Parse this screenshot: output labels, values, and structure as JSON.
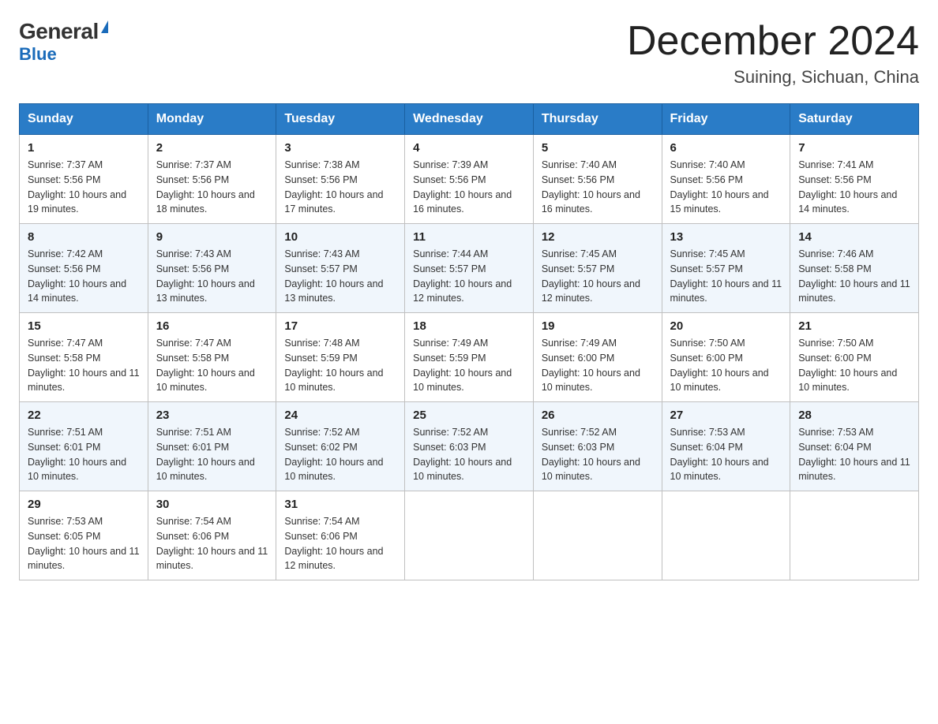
{
  "header": {
    "logo_general": "General",
    "logo_blue": "Blue",
    "month_year": "December 2024",
    "location": "Suining, Sichuan, China"
  },
  "weekdays": [
    "Sunday",
    "Monday",
    "Tuesday",
    "Wednesday",
    "Thursday",
    "Friday",
    "Saturday"
  ],
  "weeks": [
    [
      {
        "day": "1",
        "sunrise": "7:37 AM",
        "sunset": "5:56 PM",
        "daylight": "10 hours and 19 minutes."
      },
      {
        "day": "2",
        "sunrise": "7:37 AM",
        "sunset": "5:56 PM",
        "daylight": "10 hours and 18 minutes."
      },
      {
        "day": "3",
        "sunrise": "7:38 AM",
        "sunset": "5:56 PM",
        "daylight": "10 hours and 17 minutes."
      },
      {
        "day": "4",
        "sunrise": "7:39 AM",
        "sunset": "5:56 PM",
        "daylight": "10 hours and 16 minutes."
      },
      {
        "day": "5",
        "sunrise": "7:40 AM",
        "sunset": "5:56 PM",
        "daylight": "10 hours and 16 minutes."
      },
      {
        "day": "6",
        "sunrise": "7:40 AM",
        "sunset": "5:56 PM",
        "daylight": "10 hours and 15 minutes."
      },
      {
        "day": "7",
        "sunrise": "7:41 AM",
        "sunset": "5:56 PM",
        "daylight": "10 hours and 14 minutes."
      }
    ],
    [
      {
        "day": "8",
        "sunrise": "7:42 AM",
        "sunset": "5:56 PM",
        "daylight": "10 hours and 14 minutes."
      },
      {
        "day": "9",
        "sunrise": "7:43 AM",
        "sunset": "5:56 PM",
        "daylight": "10 hours and 13 minutes."
      },
      {
        "day": "10",
        "sunrise": "7:43 AM",
        "sunset": "5:57 PM",
        "daylight": "10 hours and 13 minutes."
      },
      {
        "day": "11",
        "sunrise": "7:44 AM",
        "sunset": "5:57 PM",
        "daylight": "10 hours and 12 minutes."
      },
      {
        "day": "12",
        "sunrise": "7:45 AM",
        "sunset": "5:57 PM",
        "daylight": "10 hours and 12 minutes."
      },
      {
        "day": "13",
        "sunrise": "7:45 AM",
        "sunset": "5:57 PM",
        "daylight": "10 hours and 11 minutes."
      },
      {
        "day": "14",
        "sunrise": "7:46 AM",
        "sunset": "5:58 PM",
        "daylight": "10 hours and 11 minutes."
      }
    ],
    [
      {
        "day": "15",
        "sunrise": "7:47 AM",
        "sunset": "5:58 PM",
        "daylight": "10 hours and 11 minutes."
      },
      {
        "day": "16",
        "sunrise": "7:47 AM",
        "sunset": "5:58 PM",
        "daylight": "10 hours and 10 minutes."
      },
      {
        "day": "17",
        "sunrise": "7:48 AM",
        "sunset": "5:59 PM",
        "daylight": "10 hours and 10 minutes."
      },
      {
        "day": "18",
        "sunrise": "7:49 AM",
        "sunset": "5:59 PM",
        "daylight": "10 hours and 10 minutes."
      },
      {
        "day": "19",
        "sunrise": "7:49 AM",
        "sunset": "6:00 PM",
        "daylight": "10 hours and 10 minutes."
      },
      {
        "day": "20",
        "sunrise": "7:50 AM",
        "sunset": "6:00 PM",
        "daylight": "10 hours and 10 minutes."
      },
      {
        "day": "21",
        "sunrise": "7:50 AM",
        "sunset": "6:00 PM",
        "daylight": "10 hours and 10 minutes."
      }
    ],
    [
      {
        "day": "22",
        "sunrise": "7:51 AM",
        "sunset": "6:01 PM",
        "daylight": "10 hours and 10 minutes."
      },
      {
        "day": "23",
        "sunrise": "7:51 AM",
        "sunset": "6:01 PM",
        "daylight": "10 hours and 10 minutes."
      },
      {
        "day": "24",
        "sunrise": "7:52 AM",
        "sunset": "6:02 PM",
        "daylight": "10 hours and 10 minutes."
      },
      {
        "day": "25",
        "sunrise": "7:52 AM",
        "sunset": "6:03 PM",
        "daylight": "10 hours and 10 minutes."
      },
      {
        "day": "26",
        "sunrise": "7:52 AM",
        "sunset": "6:03 PM",
        "daylight": "10 hours and 10 minutes."
      },
      {
        "day": "27",
        "sunrise": "7:53 AM",
        "sunset": "6:04 PM",
        "daylight": "10 hours and 10 minutes."
      },
      {
        "day": "28",
        "sunrise": "7:53 AM",
        "sunset": "6:04 PM",
        "daylight": "10 hours and 11 minutes."
      }
    ],
    [
      {
        "day": "29",
        "sunrise": "7:53 AM",
        "sunset": "6:05 PM",
        "daylight": "10 hours and 11 minutes."
      },
      {
        "day": "30",
        "sunrise": "7:54 AM",
        "sunset": "6:06 PM",
        "daylight": "10 hours and 11 minutes."
      },
      {
        "day": "31",
        "sunrise": "7:54 AM",
        "sunset": "6:06 PM",
        "daylight": "10 hours and 12 minutes."
      },
      null,
      null,
      null,
      null
    ]
  ]
}
